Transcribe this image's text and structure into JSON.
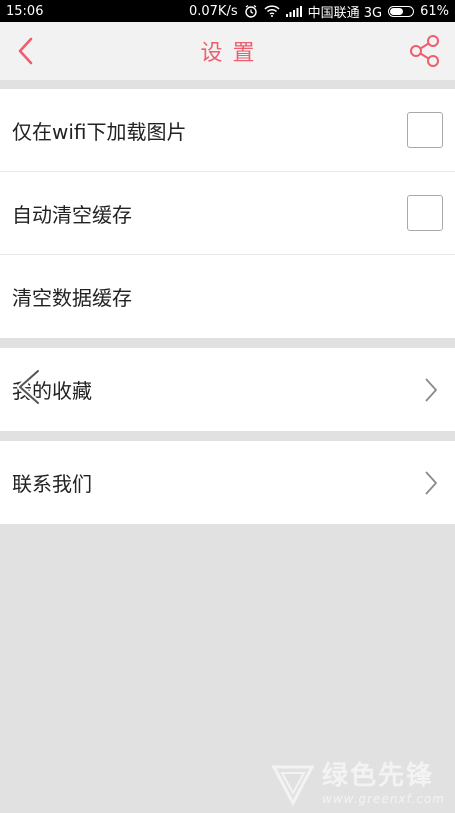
{
  "status_bar": {
    "time": "15:06",
    "speed": "0.07K/s",
    "carrier": "中国联通 3G",
    "battery_percent": 61,
    "battery_label": "61%"
  },
  "header": {
    "title": "设置",
    "accent_color": "#ef5d6e"
  },
  "settings": {
    "wifi_only_images": {
      "label": "仅在wifi下加载图片",
      "checked": false
    },
    "auto_clear_cache": {
      "label": "自动清空缓存",
      "checked": false
    },
    "clear_data_cache": {
      "label": "清空数据缓存"
    },
    "my_favorites": {
      "label": "我的收藏"
    },
    "contact_us": {
      "label": "联系我们"
    }
  },
  "watermark": {
    "name": "绿色先锋",
    "url": "www.greenxf.com"
  }
}
